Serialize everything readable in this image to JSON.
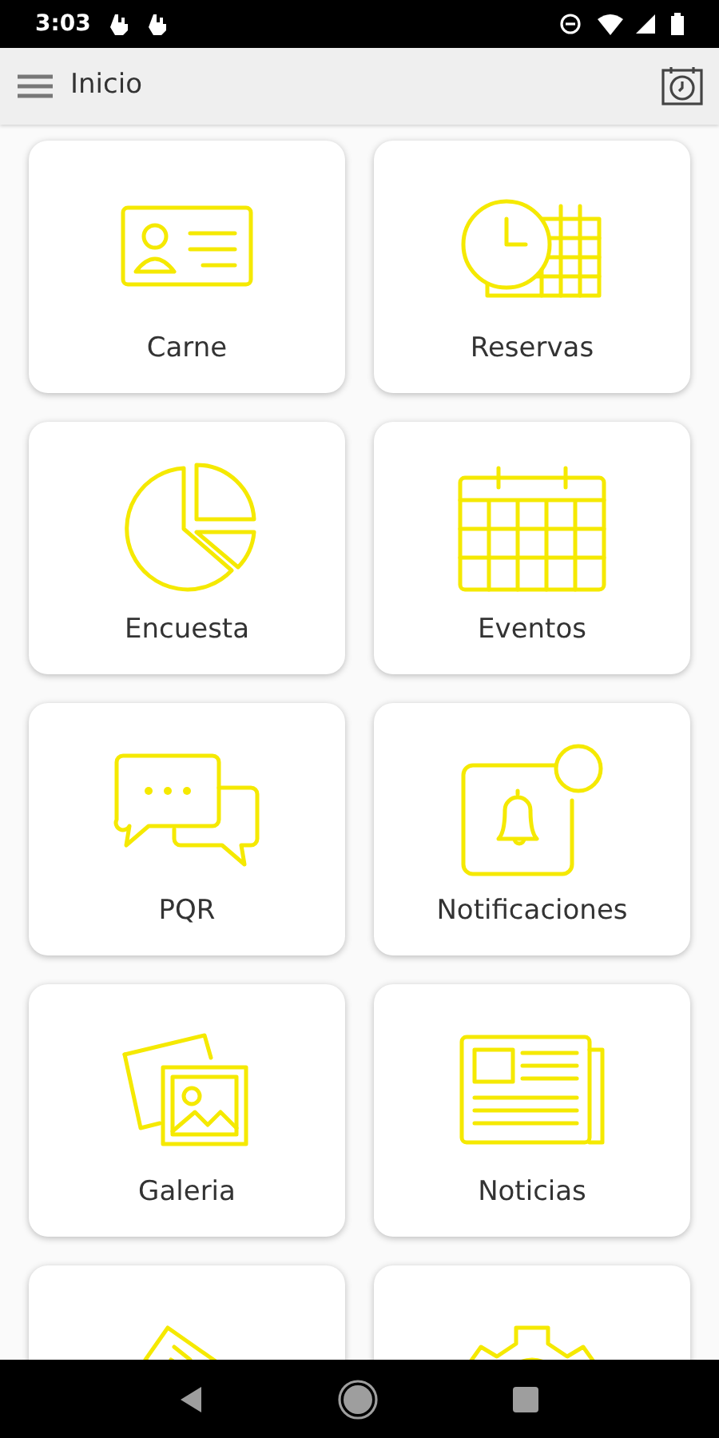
{
  "status_bar": {
    "time": "3:03"
  },
  "app_bar": {
    "title": "Inicio"
  },
  "tiles": [
    {
      "kind": "id-card",
      "label": "Carne"
    },
    {
      "kind": "clock-calendar",
      "label": "Reservas"
    },
    {
      "kind": "pie",
      "label": "Encuesta"
    },
    {
      "kind": "calendar",
      "label": "Eventos"
    },
    {
      "kind": "chat",
      "label": "PQR"
    },
    {
      "kind": "bell",
      "label": "Notificaciones"
    },
    {
      "kind": "photos",
      "label": "Galeria"
    },
    {
      "kind": "newspaper",
      "label": "Noticias"
    },
    {
      "kind": "ticket"
    },
    {
      "kind": "gear"
    }
  ]
}
